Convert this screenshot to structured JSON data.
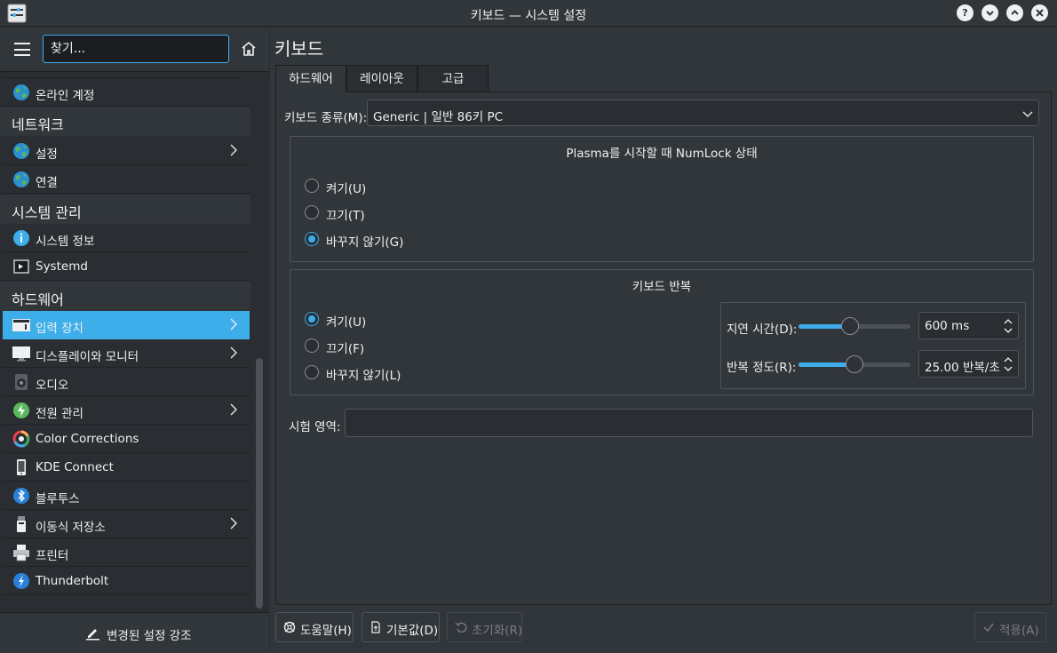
{
  "window": {
    "title": "키보드 — 시스템 설정"
  },
  "sidebar": {
    "search_placeholder": "찾기...",
    "items": [
      {
        "type": "item",
        "label": "온라인 계정",
        "icon": "globe-icon"
      },
      {
        "type": "category",
        "label": "네트워크"
      },
      {
        "type": "item",
        "label": "설정",
        "icon": "globe-icon",
        "chevron": true
      },
      {
        "type": "item",
        "label": "연결",
        "icon": "globe-icon"
      },
      {
        "type": "category",
        "label": "시스템 관리"
      },
      {
        "type": "item",
        "label": "시스템 정보",
        "icon": "info-icon"
      },
      {
        "type": "item",
        "label": "Systemd",
        "icon": "systemd-icon"
      },
      {
        "type": "category",
        "label": "하드웨어"
      },
      {
        "type": "item",
        "label": "입력 장치",
        "icon": "keyboard-icon",
        "chevron": true,
        "active": true
      },
      {
        "type": "item",
        "label": "디스플레이와 모니터",
        "icon": "monitor-icon",
        "chevron": true
      },
      {
        "type": "item",
        "label": "오디오",
        "icon": "speaker-icon"
      },
      {
        "type": "item",
        "label": "전원 관리",
        "icon": "power-icon",
        "chevron": true
      },
      {
        "type": "item",
        "label": "Color Corrections",
        "icon": "color-wheel-icon"
      },
      {
        "type": "item",
        "label": "KDE Connect",
        "icon": "phone-icon"
      },
      {
        "type": "item",
        "label": "블루투스",
        "icon": "bluetooth-icon"
      },
      {
        "type": "item",
        "label": "이동식 저장소",
        "icon": "usb-icon",
        "chevron": true
      },
      {
        "type": "item",
        "label": "프린터",
        "icon": "printer-icon"
      },
      {
        "type": "item",
        "label": "Thunderbolt",
        "icon": "thunderbolt-icon"
      }
    ],
    "highlight_button": "변경된 설정 강조"
  },
  "page": {
    "title": "키보드",
    "tabs": [
      "하드웨어",
      "레이아웃",
      "고급"
    ],
    "active_tab": "하드웨어",
    "keyboard_model_label": "키보드 종류(M):",
    "keyboard_model_value": "Generic | 일반 86키 PC",
    "numlock": {
      "title": "Plasma를 시작할 때 NumLock 상태",
      "options": [
        "켜기(U)",
        "끄기(T)",
        "바꾸지 않기(G)"
      ],
      "selected": "바꾸지 않기(G)"
    },
    "repeat": {
      "title": "키보드 반복",
      "options": [
        "켜기(U)",
        "끄기(F)",
        "바꾸지 않기(L)"
      ],
      "selected": "켜기(U)",
      "delay_label": "지연 시간(D):",
      "delay_value": "600 ms",
      "delay_slider_fraction": 0.46,
      "rate_label": "반복 정도(R):",
      "rate_value": "25.00 반복/초",
      "rate_slider_fraction": 0.5
    },
    "test_area_label": "시험 영역:",
    "test_area_value": ""
  },
  "buttons": {
    "help": "도움말(H)",
    "defaults": "기본값(D)",
    "reset": "초기화(R)",
    "apply": "적용(A)"
  },
  "colors": {
    "accent": "#3daee9",
    "window_bg": "#31363b",
    "view_bg": "#2a2e32",
    "text": "#eff0f1"
  }
}
